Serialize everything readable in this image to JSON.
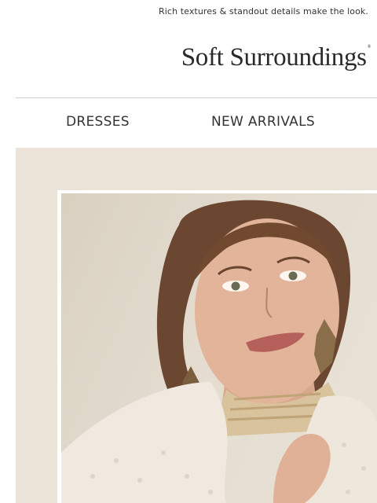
{
  "preheader": {
    "text": "Rich textures & standout details make the look."
  },
  "brand": {
    "logo_text": "Soft Surroundings",
    "trademark": "®"
  },
  "nav": {
    "items": [
      {
        "label": "DRESSES"
      },
      {
        "label": "NEW ARRIVALS"
      }
    ]
  },
  "hero": {
    "image_subject": "woman-in-sherpa-jacket-photo"
  },
  "colors": {
    "hero_background": "#ebe3d7",
    "frame": "#ffffff",
    "text": "#333333"
  }
}
